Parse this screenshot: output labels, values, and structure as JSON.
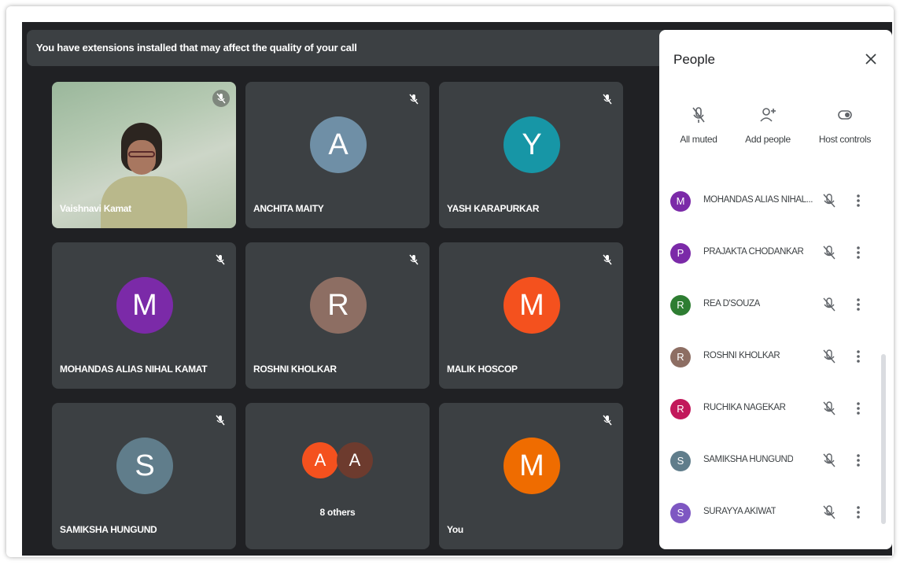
{
  "banner": {
    "text": "You have extensions installed that may affect the quality of your call"
  },
  "tiles": [
    {
      "name": "Vaishnavi Kamat",
      "type": "video"
    },
    {
      "name": "ANCHITA MAITY",
      "letter": "A",
      "color": "#6f8fa6"
    },
    {
      "name": "YASH KARAPURKAR",
      "letter": "Y",
      "color": "#1796a6"
    },
    {
      "name": "MOHANDAS ALIAS NIHAL KAMAT",
      "letter": "M",
      "color": "#7b2aa8"
    },
    {
      "name": "ROSHNI KHOLKAR",
      "letter": "R",
      "color": "#8d6e63"
    },
    {
      "name": "MALIK HOSCOP",
      "letter": "M",
      "color": "#f4511e"
    },
    {
      "name": "SAMIKSHA HUNGUND",
      "letter": "S",
      "color": "#607d8b"
    },
    {
      "label": "8 others",
      "letters": [
        "A",
        "A"
      ],
      "colors": [
        "#f4511e",
        "#6d3b2e"
      ]
    },
    {
      "name": "You",
      "letter": "M",
      "color": "#ef6c00"
    }
  ],
  "people_panel": {
    "title": "People",
    "actions": [
      {
        "label": "All muted",
        "icon": "mic-off-icon"
      },
      {
        "label": "Add people",
        "icon": "add-person-icon"
      },
      {
        "label": "Host controls",
        "icon": "host-controls-icon"
      }
    ],
    "participants": [
      {
        "name": "MOHANDAS ALIAS NIHAL...",
        "letter": "M",
        "color": "#7b2aa8"
      },
      {
        "name": "PRAJAKTA CHODANKAR",
        "letter": "P",
        "color": "#7b2aa8"
      },
      {
        "name": "REA D'SOUZA",
        "letter": "R",
        "color": "#2e7d32"
      },
      {
        "name": "ROSHNI KHOLKAR",
        "letter": "R",
        "color": "#8d6e63"
      },
      {
        "name": "RUCHIKA NAGEKAR",
        "letter": "R",
        "color": "#c2185b"
      },
      {
        "name": "SAMIKSHA HUNGUND",
        "letter": "S",
        "color": "#607d8b"
      },
      {
        "name": "SURAYYA AKIWAT",
        "letter": "S",
        "color": "#7e57c2"
      }
    ]
  }
}
